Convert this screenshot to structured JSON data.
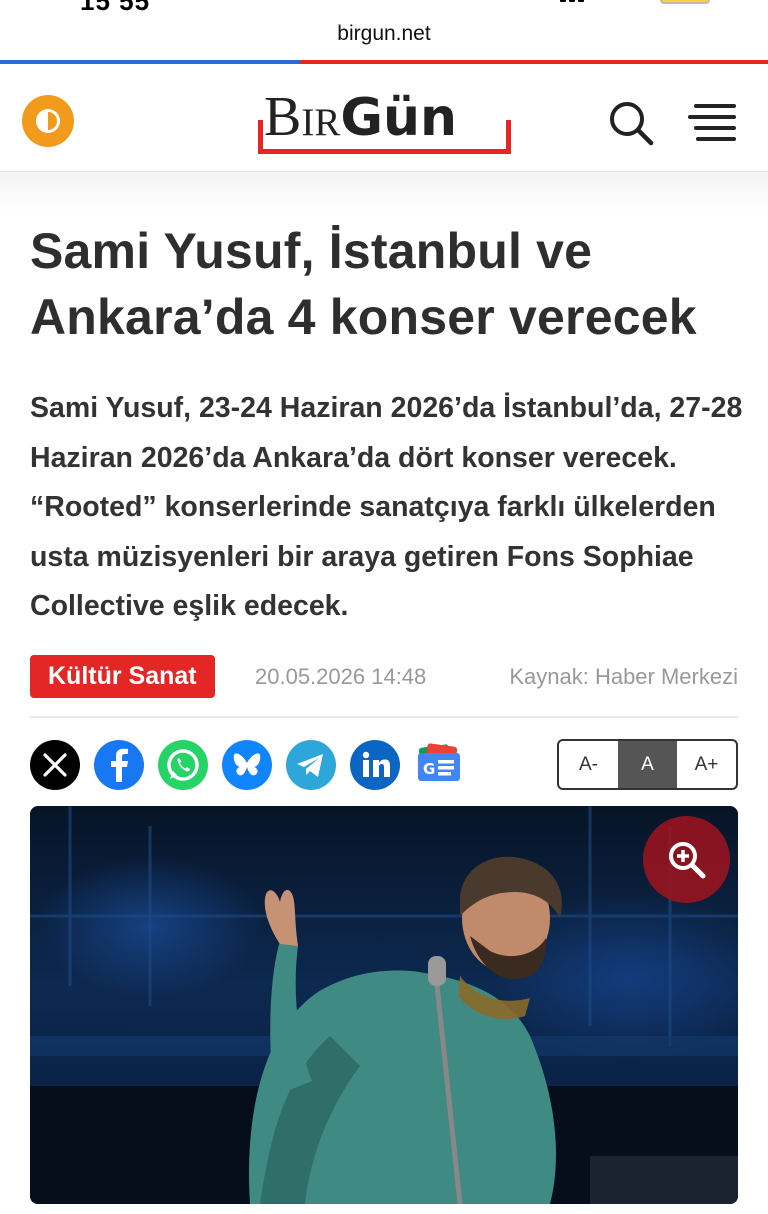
{
  "browser": {
    "url": "birgun.net",
    "load_progress": 0.39
  },
  "header": {
    "logo_part1": "Bir",
    "logo_part2": "Gün",
    "accent_color": "#e42625",
    "toggle_color": "#f29a1c",
    "icons": [
      "theme-toggle-icon",
      "search-icon",
      "menu-icon"
    ]
  },
  "article": {
    "title": "Sami Yusuf, İstanbul ve Ankara’da 4 konser verecek",
    "summary": "Sami Yusuf, 23-24 Haziran 2026’da İstanbul’da, 27-28 Haziran 2026’da Ankara’da dört konser verecek. “Rooted” konserlerinde sanatçıya farklı ülkelerden usta müzisyenleri bir araya getiren Fons Sophiae Collective eşlik edecek.",
    "category": "Kültür Sanat",
    "date": "20.05.2026 14:48",
    "source": "Kaynak: Haber Merkezi"
  },
  "share": {
    "icons": [
      "x-icon",
      "facebook-icon",
      "whatsapp-icon",
      "bluesky-icon",
      "telegram-icon",
      "linkedin-icon",
      "google-news-icon"
    ]
  },
  "font_size": {
    "decrease": "A-",
    "normal": "A",
    "increase": "A+",
    "selected": "A"
  },
  "photo": {
    "icon": "zoom-in-icon"
  }
}
